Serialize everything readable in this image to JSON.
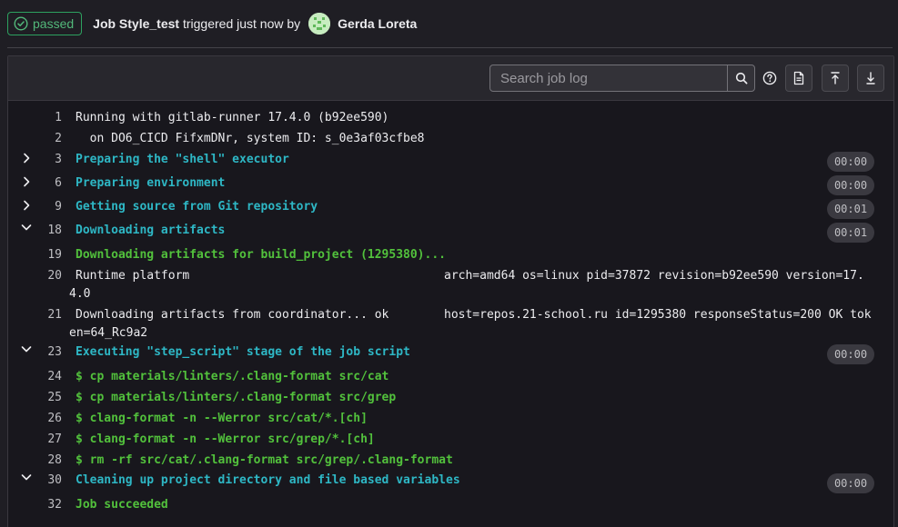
{
  "header": {
    "status": "passed",
    "job_name": "Job Style_test",
    "triggered_text": "triggered just now by",
    "user_name": "Gerda Loreta"
  },
  "toolbar": {
    "search_placeholder": "Search job log",
    "icons": [
      "search-icon",
      "help-icon",
      "raw-log-icon",
      "scroll-to-top-icon",
      "scroll-to-bottom-icon"
    ]
  },
  "colors": {
    "status_green": "#2da160",
    "section_cyan": "#2eb7c5",
    "command_green": "#52c13c",
    "background": "#1f1e24"
  },
  "log": {
    "l1": {
      "num": "1",
      "text": "Running with gitlab-runner 17.4.0 (b92ee590)"
    },
    "l2": {
      "num": "2",
      "text": "  on DO6_CICD FifxmDNr, system ID: s_0e3af03cfbe8"
    },
    "l3": {
      "num": "3",
      "text": "Preparing the \"shell\" executor",
      "duration": "00:00",
      "state": "collapsed"
    },
    "l6": {
      "num": "6",
      "text": "Preparing environment",
      "duration": "00:00",
      "state": "collapsed"
    },
    "l9": {
      "num": "9",
      "text": "Getting source from Git repository",
      "duration": "00:01",
      "state": "collapsed"
    },
    "l18": {
      "num": "18",
      "text": "Downloading artifacts",
      "duration": "00:01",
      "state": "expanded"
    },
    "l19": {
      "num": "19",
      "text": "Downloading artifacts for build_project (1295380)..."
    },
    "l20": {
      "num": "20",
      "text": "Runtime platform",
      "text_right": "arch=amd64 os=linux pid=37872 revision=b92ee590 version=17.",
      "text_wrap": "4.0"
    },
    "l21": {
      "num": "21",
      "text": "Downloading artifacts from coordinator... ok",
      "text_right": "host=repos.21-school.ru id=1295380 responseStatus=200 OK tok",
      "text_wrap": "en=64_Rc9a2"
    },
    "l23": {
      "num": "23",
      "text": "Executing \"step_script\" stage of the job script",
      "duration": "00:00",
      "state": "expanded"
    },
    "l24": {
      "num": "24",
      "text": "$ cp materials/linters/.clang-format src/cat"
    },
    "l25": {
      "num": "25",
      "text": "$ cp materials/linters/.clang-format src/grep"
    },
    "l26": {
      "num": "26",
      "text": "$ clang-format -n --Werror src/cat/*.[ch]"
    },
    "l27": {
      "num": "27",
      "text": "$ clang-format -n --Werror src/grep/*.[ch]"
    },
    "l28": {
      "num": "28",
      "text": "$ rm -rf src/cat/.clang-format src/grep/.clang-format"
    },
    "l30": {
      "num": "30",
      "text": "Cleaning up project directory and file based variables",
      "duration": "00:00",
      "state": "expanded"
    },
    "l32": {
      "num": "32",
      "text": "Job succeeded"
    }
  }
}
